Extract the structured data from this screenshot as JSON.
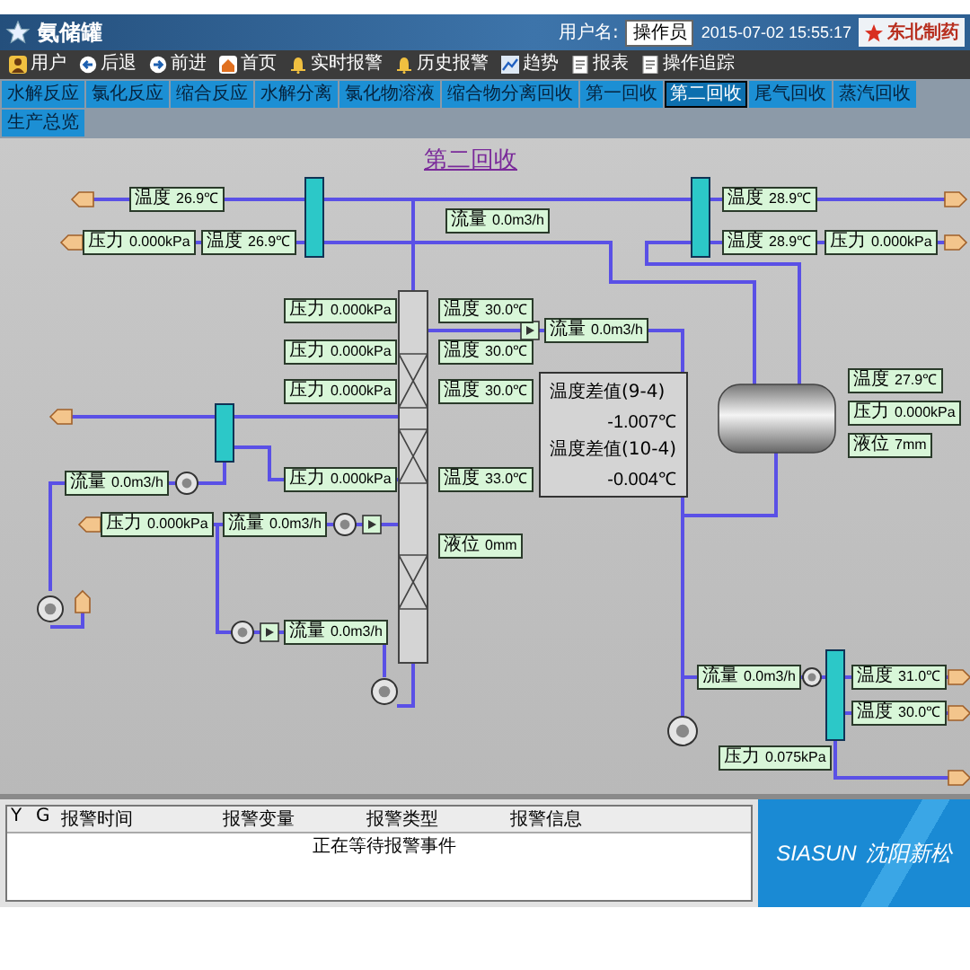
{
  "header": {
    "title": "氨储罐",
    "user_label": "用户名:",
    "user_value": "操作员",
    "datetime": "2015-07-02 15:55:17",
    "company": "东北制药"
  },
  "toolbar": [
    {
      "label": "用户"
    },
    {
      "label": "后退"
    },
    {
      "label": "前进"
    },
    {
      "label": "首页"
    },
    {
      "label": "实时报警"
    },
    {
      "label": "历史报警"
    },
    {
      "label": "趋势"
    },
    {
      "label": "报表"
    },
    {
      "label": "操作追踪"
    }
  ],
  "tabs": [
    {
      "label": "水解反应",
      "selected": false
    },
    {
      "label": "氯化反应",
      "selected": false
    },
    {
      "label": "缩合反应",
      "selected": false
    },
    {
      "label": "水解分离",
      "selected": false
    },
    {
      "label": "氯化物溶液",
      "selected": false
    },
    {
      "label": "缩合物分离回收",
      "selected": false
    },
    {
      "label": "第一回收",
      "selected": false
    },
    {
      "label": "第二回收",
      "selected": true
    },
    {
      "label": "尾气回收",
      "selected": false
    },
    {
      "label": "蒸汽回收",
      "selected": false
    },
    {
      "label": "生产总览",
      "selected": false
    }
  ],
  "diagram": {
    "title": "第二回收",
    "readings": [
      {
        "label": "温度",
        "value": "26.9℃"
      },
      {
        "label": "压力",
        "value": "0.000kPa"
      },
      {
        "label": "温度",
        "value": "26.9℃"
      },
      {
        "label": "流量",
        "value": "0.0m3/h"
      },
      {
        "label": "温度",
        "value": "28.9℃"
      },
      {
        "label": "温度",
        "value": "28.9℃"
      },
      {
        "label": "压力",
        "value": "0.000kPa"
      },
      {
        "label": "压力",
        "value": "0.000kPa"
      },
      {
        "label": "温度",
        "value": "30.0℃"
      },
      {
        "label": "流量",
        "value": "0.0m3/h"
      },
      {
        "label": "压力",
        "value": "0.000kPa"
      },
      {
        "label": "温度",
        "value": "30.0℃"
      },
      {
        "label": "压力",
        "value": "0.000kPa"
      },
      {
        "label": "温度",
        "value": "30.0℃"
      },
      {
        "label": "温度",
        "value": "27.9℃"
      },
      {
        "label": "压力",
        "value": "0.000kPa"
      },
      {
        "label": "液位",
        "value": "7mm"
      },
      {
        "label": "流量",
        "value": "0.0m3/h"
      },
      {
        "label": "压力",
        "value": "0.000kPa"
      },
      {
        "label": "温度",
        "value": "33.0℃"
      },
      {
        "label": "压力",
        "value": "0.000kPa"
      },
      {
        "label": "流量",
        "value": "0.0m3/h"
      },
      {
        "label": "液位",
        "value": "0mm"
      },
      {
        "label": "流量",
        "value": "0.0m3/h"
      },
      {
        "label": "流量",
        "value": "0.0m3/h"
      },
      {
        "label": "温度",
        "value": "31.0℃"
      },
      {
        "label": "温度",
        "value": "30.0℃"
      },
      {
        "label": "压力",
        "value": "0.075kPa"
      }
    ],
    "difference_panel": [
      {
        "label": "温度差值(9-4)",
        "value": "-1.007℃"
      },
      {
        "label": "温度差值(10-4)",
        "value": "-0.004℃"
      }
    ]
  },
  "alarm_panel": {
    "columns": [
      "Y",
      "G",
      "报警时间",
      "报警变量",
      "报警类型",
      "报警信息"
    ],
    "message": "正在等待报警事件"
  },
  "brand": {
    "name": "SIASUN",
    "local_name": "沈阳新松"
  }
}
